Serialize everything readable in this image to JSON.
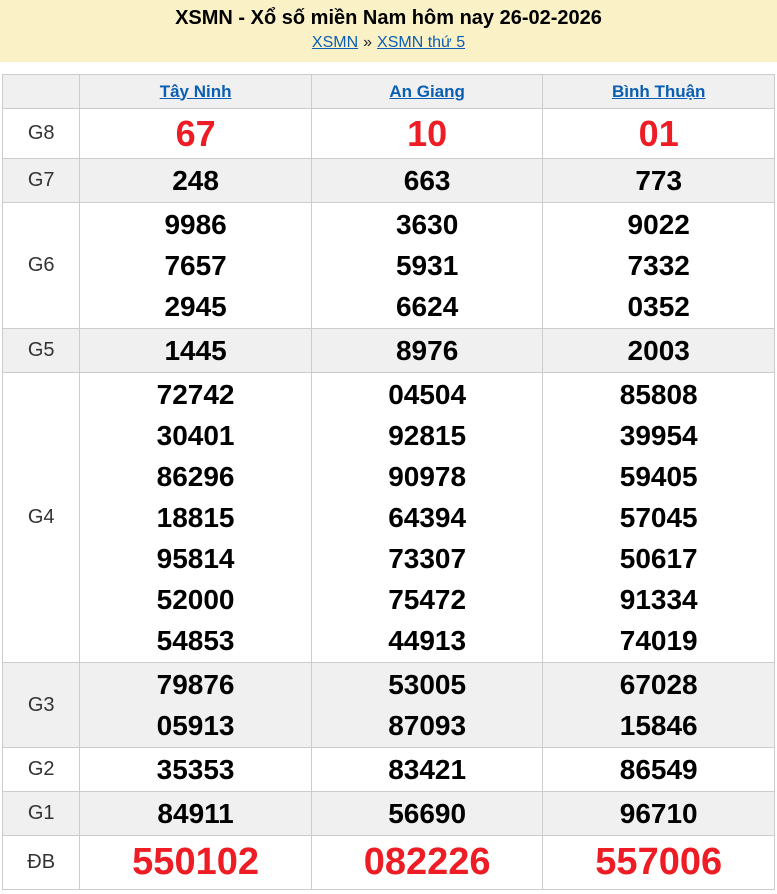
{
  "header": {
    "title": "XSMN - Xổ số miền Nam hôm nay 26-02-2026",
    "breadcrumb": {
      "link1": "XSMN",
      "separator": "»",
      "link2": "XSMN thứ 5"
    }
  },
  "colors": {
    "banner_bg": "#fbf1c6",
    "link_blue": "#0a5eb4",
    "highlight_red": "#ee1c24",
    "row_alt_bg": "#f0f0f0",
    "border": "#cccccc"
  },
  "table": {
    "province_columns": [
      "Tây Ninh",
      "An Giang",
      "Bình Thuận"
    ],
    "rows": [
      {
        "label": "G8",
        "size": "large",
        "values": [
          [
            "67"
          ],
          [
            "10"
          ],
          [
            "01"
          ]
        ]
      },
      {
        "label": "G7",
        "size": "normal",
        "values": [
          [
            "248"
          ],
          [
            "663"
          ],
          [
            "773"
          ]
        ]
      },
      {
        "label": "G6",
        "size": "normal",
        "values": [
          [
            "9986",
            "7657",
            "2945"
          ],
          [
            "3630",
            "5931",
            "6624"
          ],
          [
            "9022",
            "7332",
            "0352"
          ]
        ]
      },
      {
        "label": "G5",
        "size": "normal",
        "values": [
          [
            "1445"
          ],
          [
            "8976"
          ],
          [
            "2003"
          ]
        ]
      },
      {
        "label": "G4",
        "size": "normal",
        "values": [
          [
            "72742",
            "30401",
            "86296",
            "18815",
            "95814",
            "52000",
            "54853"
          ],
          [
            "04504",
            "92815",
            "90978",
            "64394",
            "73307",
            "75472",
            "44913"
          ],
          [
            "85808",
            "39954",
            "59405",
            "57045",
            "50617",
            "91334",
            "74019"
          ]
        ]
      },
      {
        "label": "G3",
        "size": "normal",
        "values": [
          [
            "79876",
            "05913"
          ],
          [
            "53005",
            "87093"
          ],
          [
            "67028",
            "15846"
          ]
        ]
      },
      {
        "label": "G2",
        "size": "normal",
        "values": [
          [
            "35353"
          ],
          [
            "83421"
          ],
          [
            "86549"
          ]
        ]
      },
      {
        "label": "G1",
        "size": "normal",
        "values": [
          [
            "84911"
          ],
          [
            "56690"
          ],
          [
            "96710"
          ]
        ]
      },
      {
        "label": "ĐB",
        "size": "xlarge",
        "values": [
          [
            "550102"
          ],
          [
            "082226"
          ],
          [
            "557006"
          ]
        ]
      }
    ]
  }
}
